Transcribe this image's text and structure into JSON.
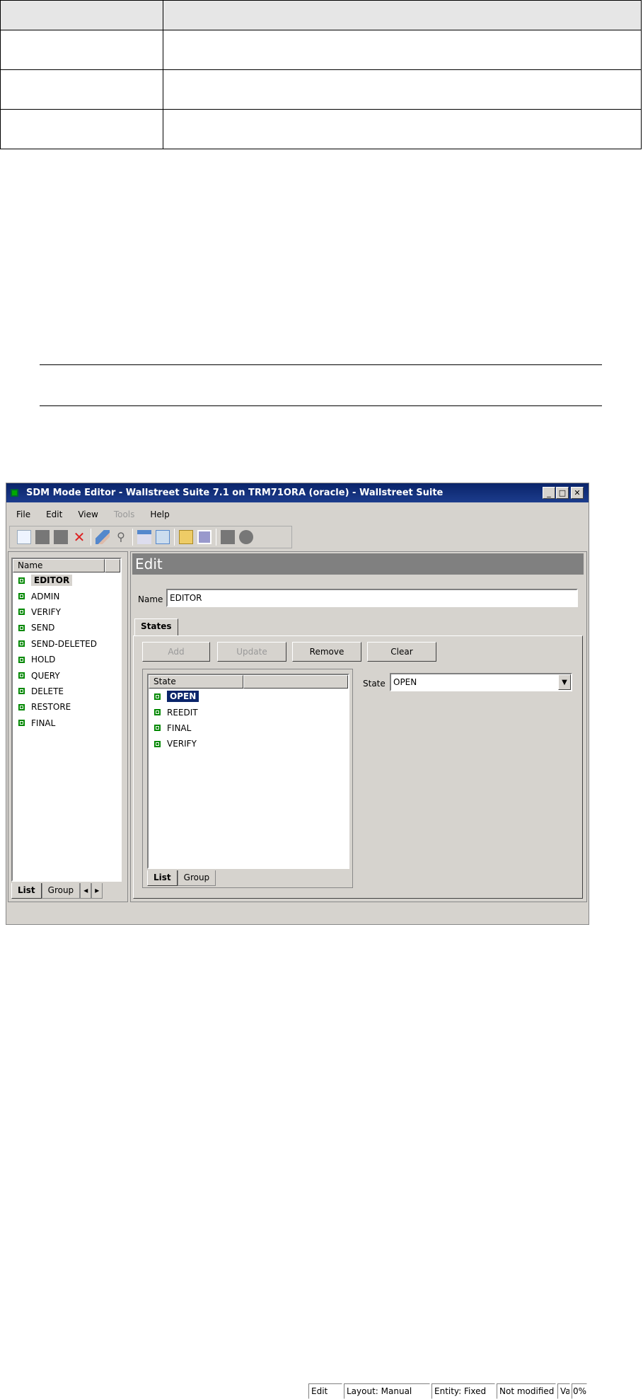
{
  "doc_table": {
    "header": [
      "",
      ""
    ],
    "rows": [
      [
        "",
        ""
      ],
      [
        "",
        ""
      ],
      [
        "",
        ""
      ]
    ]
  },
  "window": {
    "title": "SDM Mode Editor - Wallstreet Suite 7.1 on TRM71ORA (oracle) - Wallstreet Suite",
    "controls": {
      "minimize": "_",
      "maximize": "□",
      "close": "✕"
    },
    "menu": [
      {
        "label": "File",
        "enabled": true
      },
      {
        "label": "Edit",
        "enabled": true
      },
      {
        "label": "View",
        "enabled": true
      },
      {
        "label": "Tools",
        "enabled": false
      },
      {
        "label": "Help",
        "enabled": true
      }
    ],
    "toolbar": [
      "new-icon",
      "save-icon",
      "save-all-icon",
      "delete-icon",
      "eraser-icon",
      "find-icon",
      "table-icon",
      "tree-icon",
      "open-folder-icon",
      "properties-icon",
      "stop-icon",
      "settings-icon"
    ],
    "left": {
      "column": "Name",
      "items": [
        "EDITOR",
        "ADMIN",
        "VERIFY",
        "SEND",
        "SEND-DELETED",
        "HOLD",
        "QUERY",
        "DELETE",
        "RESTORE",
        "FINAL"
      ],
      "selected": "EDITOR",
      "tabs": [
        "List",
        "Group"
      ]
    },
    "edit": {
      "heading": "Edit",
      "name_label": "Name",
      "name_value": "EDITOR",
      "tab": "States",
      "buttons": [
        {
          "label": "Add",
          "enabled": false
        },
        {
          "label": "Update",
          "enabled": false
        },
        {
          "label": "Remove",
          "enabled": true
        },
        {
          "label": "Clear",
          "enabled": true
        }
      ],
      "state_column": "State",
      "states": [
        "OPEN",
        "REEDIT",
        "FINAL",
        "VERIFY"
      ],
      "selected_state": "OPEN",
      "state_label": "State",
      "state_value": "OPEN",
      "list_tabs": [
        "List",
        "Group"
      ]
    },
    "status": [
      "Edit",
      "Layout: Manual",
      "Entity: Fixed",
      "Not modified",
      "Va",
      "0%"
    ]
  }
}
